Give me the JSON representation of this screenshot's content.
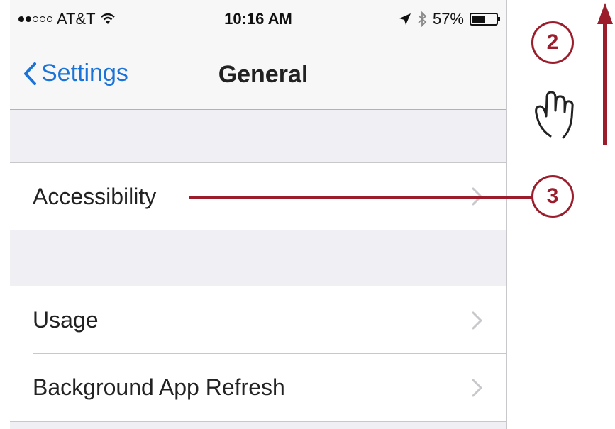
{
  "status_bar": {
    "carrier": "AT&T",
    "time": "10:16 AM",
    "battery_percent": "57%",
    "battery_level": 0.57,
    "icons": [
      "signal-dots-icon",
      "wifi-icon",
      "location-arrow-icon",
      "bluetooth-icon",
      "battery-icon"
    ]
  },
  "nav": {
    "back_label": "Settings",
    "title": "General"
  },
  "rows": [
    {
      "label": "Accessibility"
    },
    {
      "label": "Usage"
    },
    {
      "label": "Background App Refresh"
    }
  ],
  "annotations": {
    "step2": "2",
    "step3": "3",
    "accent": "#9b1d2b"
  },
  "colors": {
    "ios_blue": "#1a73d8",
    "group_bg": "#efeff4",
    "separator": "#c8c7cc"
  }
}
